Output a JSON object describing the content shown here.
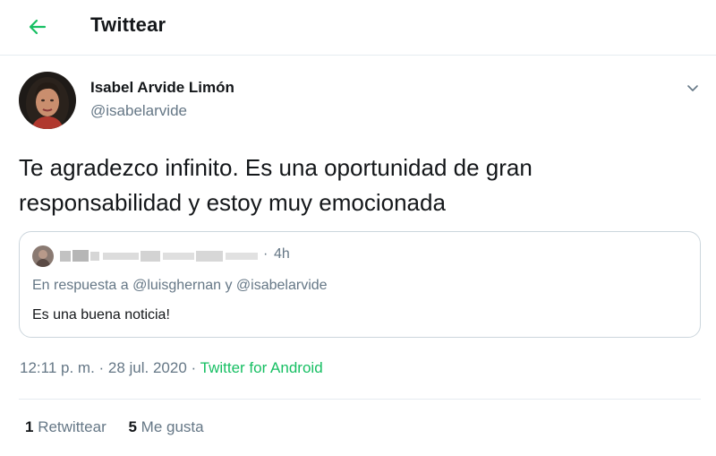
{
  "header": {
    "title": "Twittear"
  },
  "tweet": {
    "author_name": "Isabel Arvide Limón",
    "author_handle": "@isabelarvide",
    "text": "Te agradezco infinito. Es una oportunidad de gran responsabilidad y estoy muy emocionada",
    "timestamp": "12:11 p. m. · 28 jul. 2020",
    "separator": "·",
    "source": "Twitter for Android"
  },
  "quoted_tweet": {
    "author_name_redacted": true,
    "separator": "·",
    "time": "4h",
    "reply_context": "En respuesta a @luisghernan y @isabelarvide",
    "text": "Es una buena noticia!"
  },
  "stats": {
    "retweets_count": "1",
    "retweets_label": "Retwittear",
    "likes_count": "5",
    "likes_label": "Me gusta"
  },
  "colors": {
    "accent": "#17bf63",
    "text_primary": "#14171a",
    "text_secondary": "#657786",
    "border": "#e6ecf0"
  },
  "icons": {
    "back": "arrow-left-icon",
    "more": "chevron-down-icon"
  }
}
